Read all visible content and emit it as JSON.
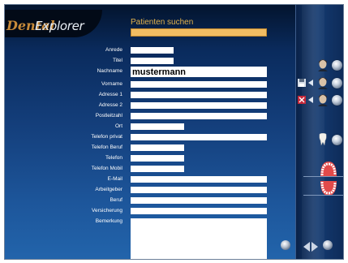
{
  "app": {
    "logo_part1": "Dental",
    "logo_part2": "Explorer"
  },
  "title": "Patienten suchen",
  "search": {
    "value": ""
  },
  "form": {
    "fields": [
      {
        "label": "Anrede",
        "value": ""
      },
      {
        "label": "Titel",
        "value": ""
      },
      {
        "label": "Nachname",
        "value": "mustermann"
      },
      {
        "label": "Vorname",
        "value": ""
      },
      {
        "label": "Adresse 1",
        "value": ""
      },
      {
        "label": "Adresse 2",
        "value": ""
      },
      {
        "label": "Postleitzahl",
        "value": ""
      },
      {
        "label": "Ort",
        "value": ""
      },
      {
        "label": "Telefon privat",
        "value": ""
      },
      {
        "label": "Telefon Beruf",
        "value": ""
      },
      {
        "label": "Telefon",
        "value": ""
      },
      {
        "label": "Telefon Mobil",
        "value": ""
      },
      {
        "label": "E-Mail",
        "value": ""
      },
      {
        "label": "Arbeitgeber",
        "value": ""
      },
      {
        "label": "Beruf",
        "value": ""
      },
      {
        "label": "Versicherung",
        "value": ""
      },
      {
        "label": "Bemerkung",
        "value": ""
      }
    ]
  },
  "sidebar": {
    "icons": [
      "patient-face-icon",
      "save-icon",
      "delete-icon",
      "tooth-icon",
      "jaw-model-icon"
    ]
  },
  "colors": {
    "accent": "#f2bd63",
    "title": "#e2b24c",
    "background": "#0d2f66"
  }
}
